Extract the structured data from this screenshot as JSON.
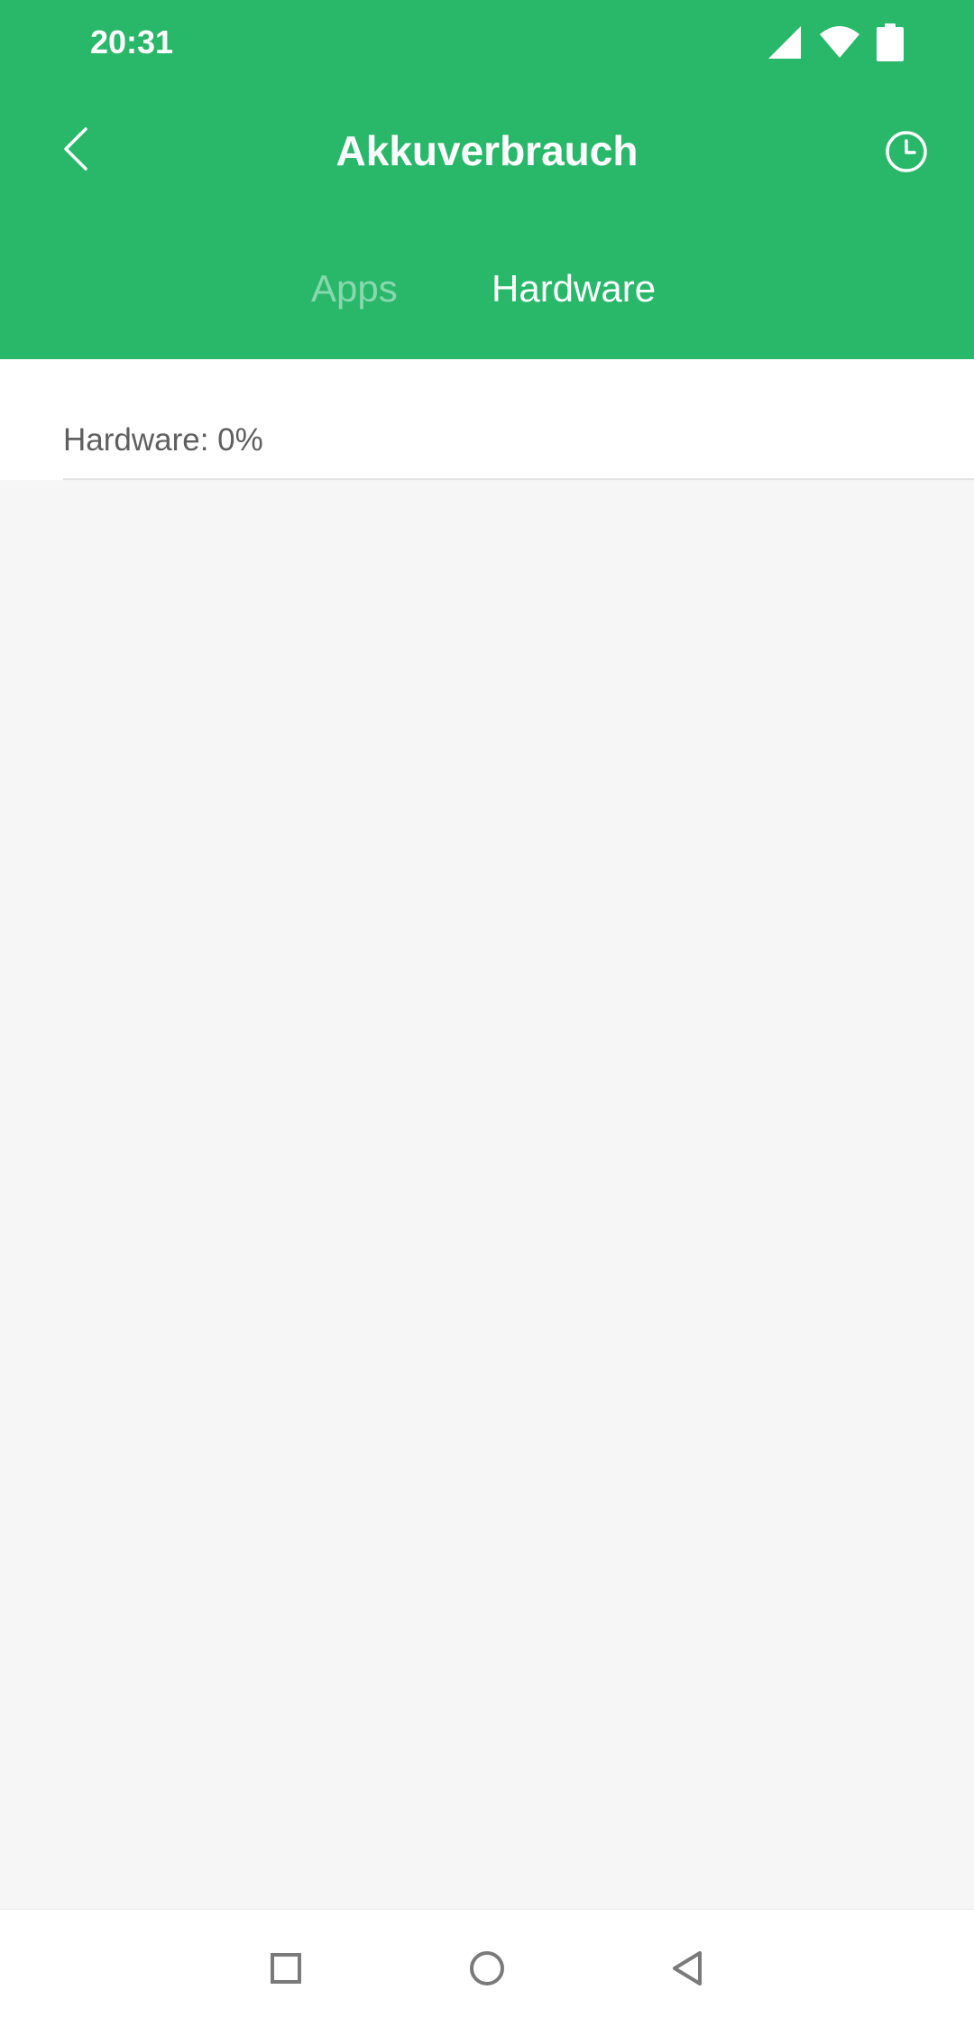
{
  "status_bar": {
    "time": "20:31",
    "icons": [
      "signal-icon",
      "wifi-icon",
      "battery-icon"
    ]
  },
  "toolbar": {
    "title": "Akkuverbrauch",
    "back_icon": "chevron-left-icon",
    "history_icon": "clock-icon"
  },
  "tabs": [
    {
      "label": "Apps",
      "active": false
    },
    {
      "label": "Hardware",
      "active": true
    }
  ],
  "summary": {
    "text": "Hardware: 0%"
  },
  "nav_bar": {
    "icons": [
      "square-icon",
      "circle-icon",
      "triangle-back-icon"
    ]
  },
  "colors": {
    "accent": "#29b86a",
    "background": "#f6f6f6",
    "text_secondary": "#5f5f5f"
  }
}
